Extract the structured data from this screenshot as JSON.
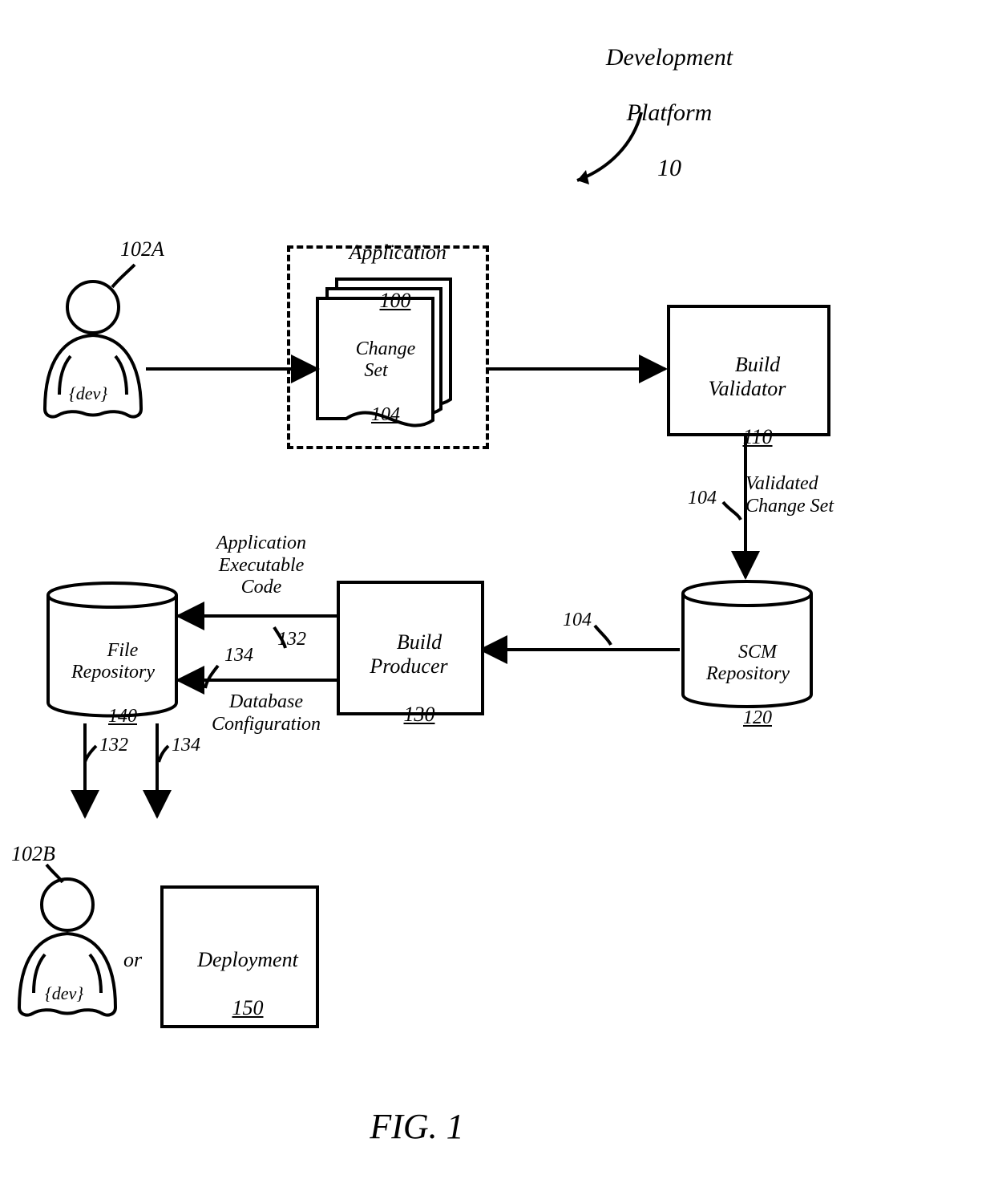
{
  "header": {
    "title_line1": "Development",
    "title_line2": "Platform",
    "title_ref": "10"
  },
  "dev_a": {
    "ref": "102A",
    "label": "{dev}"
  },
  "dev_b": {
    "ref": "102B",
    "label": "{dev}"
  },
  "application": {
    "title": "Application",
    "ref": "100",
    "changeset_label": "Change\nSet",
    "changeset_ref": "104"
  },
  "build_validator": {
    "label": "Build\nValidator",
    "ref": "110"
  },
  "validated": {
    "label": "Validated\nChange Set",
    "ref": "104"
  },
  "scm": {
    "label": "SCM\nRepository",
    "ref": "120"
  },
  "build_producer": {
    "label": "Build\nProducer",
    "ref": "130"
  },
  "file_repo": {
    "label": "File\nRepository",
    "ref": "140"
  },
  "code_out": {
    "label": "Application\nExecutable\nCode",
    "ref": "132"
  },
  "db_out": {
    "label": "Database\nConfiguration",
    "ref": "134"
  },
  "down_left_ref": "132",
  "down_right_ref": "134",
  "or_text": "or",
  "deployment": {
    "label": "Deployment",
    "ref": "150"
  },
  "figure": "FIG. 1"
}
